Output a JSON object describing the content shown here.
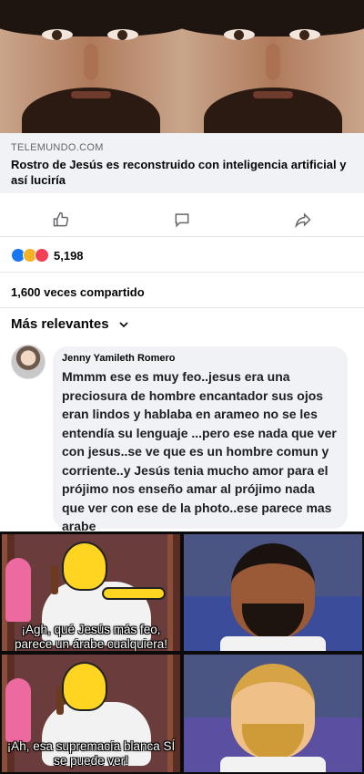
{
  "post": {
    "link": {
      "domain": "TELEMUNDO.COM",
      "title": "Rostro de Jesús es reconstruido con inteligencia artificial y así luciría"
    },
    "actions": {
      "like_icon": "thumbs-up-icon",
      "comment_icon": "comment-icon",
      "share_icon": "share-arrow-icon"
    },
    "reactions": {
      "icons": [
        "like",
        "wow",
        "love"
      ],
      "count": "5,198"
    },
    "shares": "1,600 veces compartido",
    "sort_label": "Más relevantes"
  },
  "comment": {
    "author": "Jenny Yamileth Romero",
    "text": "Mmmm ese es muy feo..jesus era una preciosura de hombre encantador  sus ojos eran lindos y hablaba en arameo no se les entendía su lenguaje ...pero ese nada que ver con jesus..se ve que es un hombre comun y corriente..y Jesús tenia mucho amor para el prójimo nos enseño amar al prójimo nada que ver con ese de la photo..ese parece mas arabe"
  },
  "meme": {
    "caption_top": "¡Agh, qué Jesús más feo, parece un árabe cualquiera!",
    "caption_bottom": "¡Ah, esa supremacía blanca SÍ se puede ver!"
  },
  "colors": {
    "accent": "#1877f2",
    "bubble": "#f0f2f5",
    "text": "#050505"
  }
}
